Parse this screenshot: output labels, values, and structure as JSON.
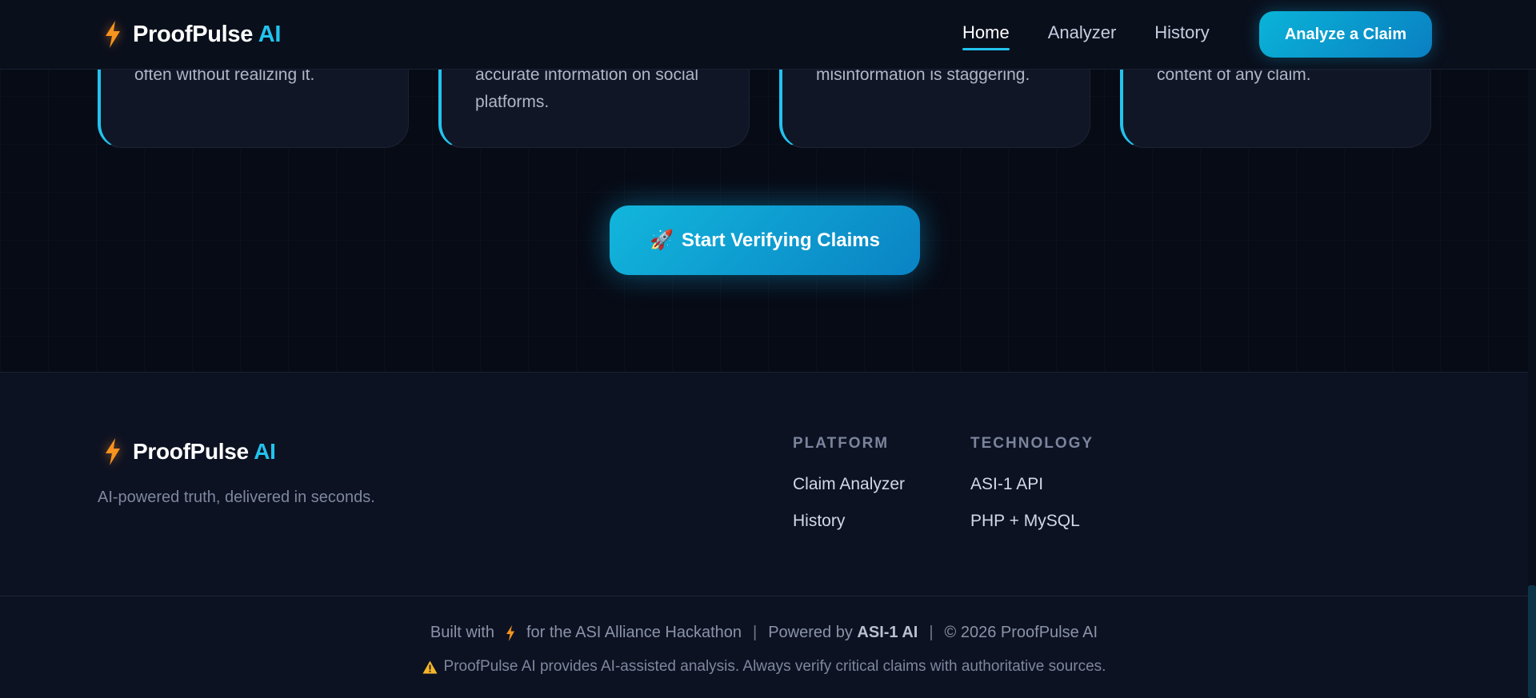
{
  "navbar": {
    "brand_name": "ProofPulse",
    "brand_suffix": "AI",
    "links": [
      {
        "label": "Home",
        "active": true
      },
      {
        "label": "Analyzer",
        "active": false
      },
      {
        "label": "History",
        "active": false
      }
    ],
    "cta_label": "Analyze a Claim",
    "brand_icon": "lightning-bolt-icon"
  },
  "cards": [
    {
      "text": "often without realizing it."
    },
    {
      "text": "accurate information on social platforms."
    },
    {
      "text": "misinformation is staggering."
    },
    {
      "text": "content of any claim."
    }
  ],
  "cta": {
    "icon": "rocket-icon",
    "icon_glyph": "🚀",
    "label": "Start Verifying Claims"
  },
  "footer": {
    "brand_name": "ProofPulse",
    "brand_suffix": "AI",
    "tagline": "AI-powered truth, delivered in seconds.",
    "columns": [
      {
        "heading": "PLATFORM",
        "links": [
          "Claim Analyzer",
          "History"
        ]
      },
      {
        "heading": "TECHNOLOGY",
        "links": [
          "ASI-1 API",
          "PHP + MySQL"
        ]
      }
    ],
    "bottom": {
      "built_prefix": "Built with",
      "built_suffix": "for the ASI Alliance Hackathon",
      "separator": "|",
      "powered_prefix": "Powered by",
      "powered_name": "ASI-1 AI",
      "copyright": "© 2026 ProofPulse AI",
      "disclaimer": "ProofPulse AI provides AI-assisted analysis. Always verify critical claims with authoritative sources.",
      "disclaimer_icon": "warning-icon"
    }
  },
  "colors": {
    "accent": "#22c3ee",
    "bolt": "#f7931e",
    "background": "#070b16",
    "footer_bg": "#0d1222"
  }
}
